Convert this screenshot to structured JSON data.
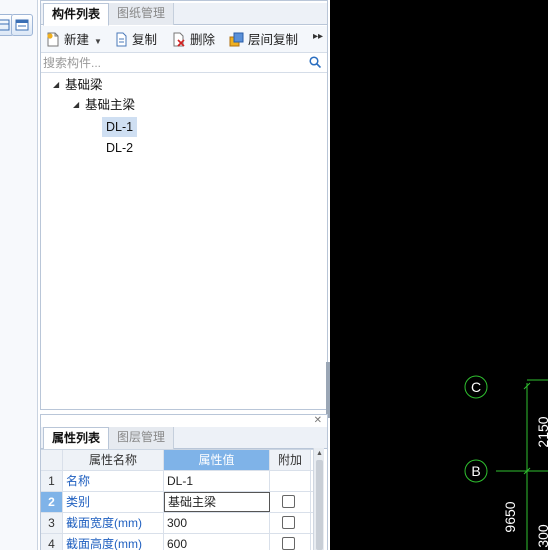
{
  "component_panel": {
    "tabs": [
      {
        "label": "构件列表",
        "active": true
      },
      {
        "label": "图纸管理",
        "active": false
      }
    ],
    "toolbar": {
      "new_label": "新建",
      "copy_label": "复制",
      "delete_label": "删除",
      "floor_copy_label": "层间复制"
    },
    "search": {
      "placeholder": "搜索构件..."
    },
    "tree": {
      "root": "基础梁",
      "group": "基础主梁",
      "items": [
        "DL-1",
        "DL-2"
      ],
      "selected": "DL-1"
    }
  },
  "property_panel": {
    "tabs": [
      {
        "label": "属性列表",
        "active": true
      },
      {
        "label": "图层管理",
        "active": false
      }
    ],
    "headers": {
      "name": "属性名称",
      "value": "属性值",
      "extra": "附加"
    },
    "rows": [
      {
        "num": "1",
        "name": "名称",
        "value": "DL-1",
        "has_check": false
      },
      {
        "num": "2",
        "name": "类别",
        "value": "基础主梁",
        "has_check": true
      },
      {
        "num": "3",
        "name": "截面宽度(mm)",
        "value": "300",
        "has_check": true
      },
      {
        "num": "4",
        "name": "截面高度(mm)",
        "value": "600",
        "has_check": true
      }
    ],
    "selected_row": "2"
  },
  "canvas": {
    "axis_labels": [
      "C",
      "B"
    ],
    "dimensions": [
      "2150",
      "9650",
      "300"
    ],
    "background": "#000000",
    "axis_color": "#2fbf2f"
  }
}
